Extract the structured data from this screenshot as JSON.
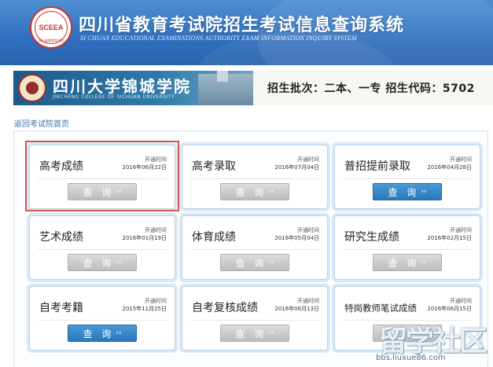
{
  "header": {
    "logo_text": "SCEEA",
    "logo_sub": "四川省教育考试院",
    "title": "四川省教育考试院招生考试信息查询系统",
    "subtitle": "SI CHUAN EDUCATIONAL EXAMINATIONS AUTHORITY EXAM INFORMATION INQUIRY SYSTEM"
  },
  "banner": {
    "college_cn": "四川大学锦城学院",
    "college_en": "JINCHENG COLLEGE OF SICHUAN UNIVERSITY",
    "info": "招生批次：二本、一专  招生代码：5702"
  },
  "back_link": "返回考试院首页",
  "cards": [
    {
      "name": "高考成绩",
      "open_label": "开通时间",
      "open_date": "2016年06月22日",
      "button": "查 询",
      "active": false
    },
    {
      "name": "高考录取",
      "open_label": "开通时间",
      "open_date": "2016年07月04日",
      "button": "查 询",
      "active": false
    },
    {
      "name": "普招提前录取",
      "open_label": "开通时间",
      "open_date": "2016年04月28日",
      "button": "查 询",
      "active": true
    },
    {
      "name": "艺术成绩",
      "open_label": "开通时间",
      "open_date": "2016年01月19日",
      "button": "查 询",
      "active": false
    },
    {
      "name": "体育成绩",
      "open_label": "开通时间",
      "open_date": "2016年05月04日",
      "button": "查 询",
      "active": false
    },
    {
      "name": "研究生成绩",
      "open_label": "开通时间",
      "open_date": "2016年02月15日",
      "button": "查 询",
      "active": false
    },
    {
      "name": "自考考籍",
      "open_label": "开通时间",
      "open_date": "2015年11月25日",
      "button": "查 询",
      "active": true
    },
    {
      "name": "自考复核成绩",
      "open_label": "开通时间",
      "open_date": "2016年06月13日",
      "button": "查 询",
      "active": false
    },
    {
      "name": "特岗教师笔试成绩",
      "open_label": "开通时间",
      "open_date": "2016年06月15日",
      "button": "查 询",
      "active": false
    }
  ],
  "button_arrow": "››",
  "watermark": {
    "logo": "留学社区",
    "url": "bbs.liuxue86.com"
  },
  "colors": {
    "header_blue": "#2f6fbf",
    "active_button": "#2877ba",
    "highlight": "#d9534f"
  }
}
